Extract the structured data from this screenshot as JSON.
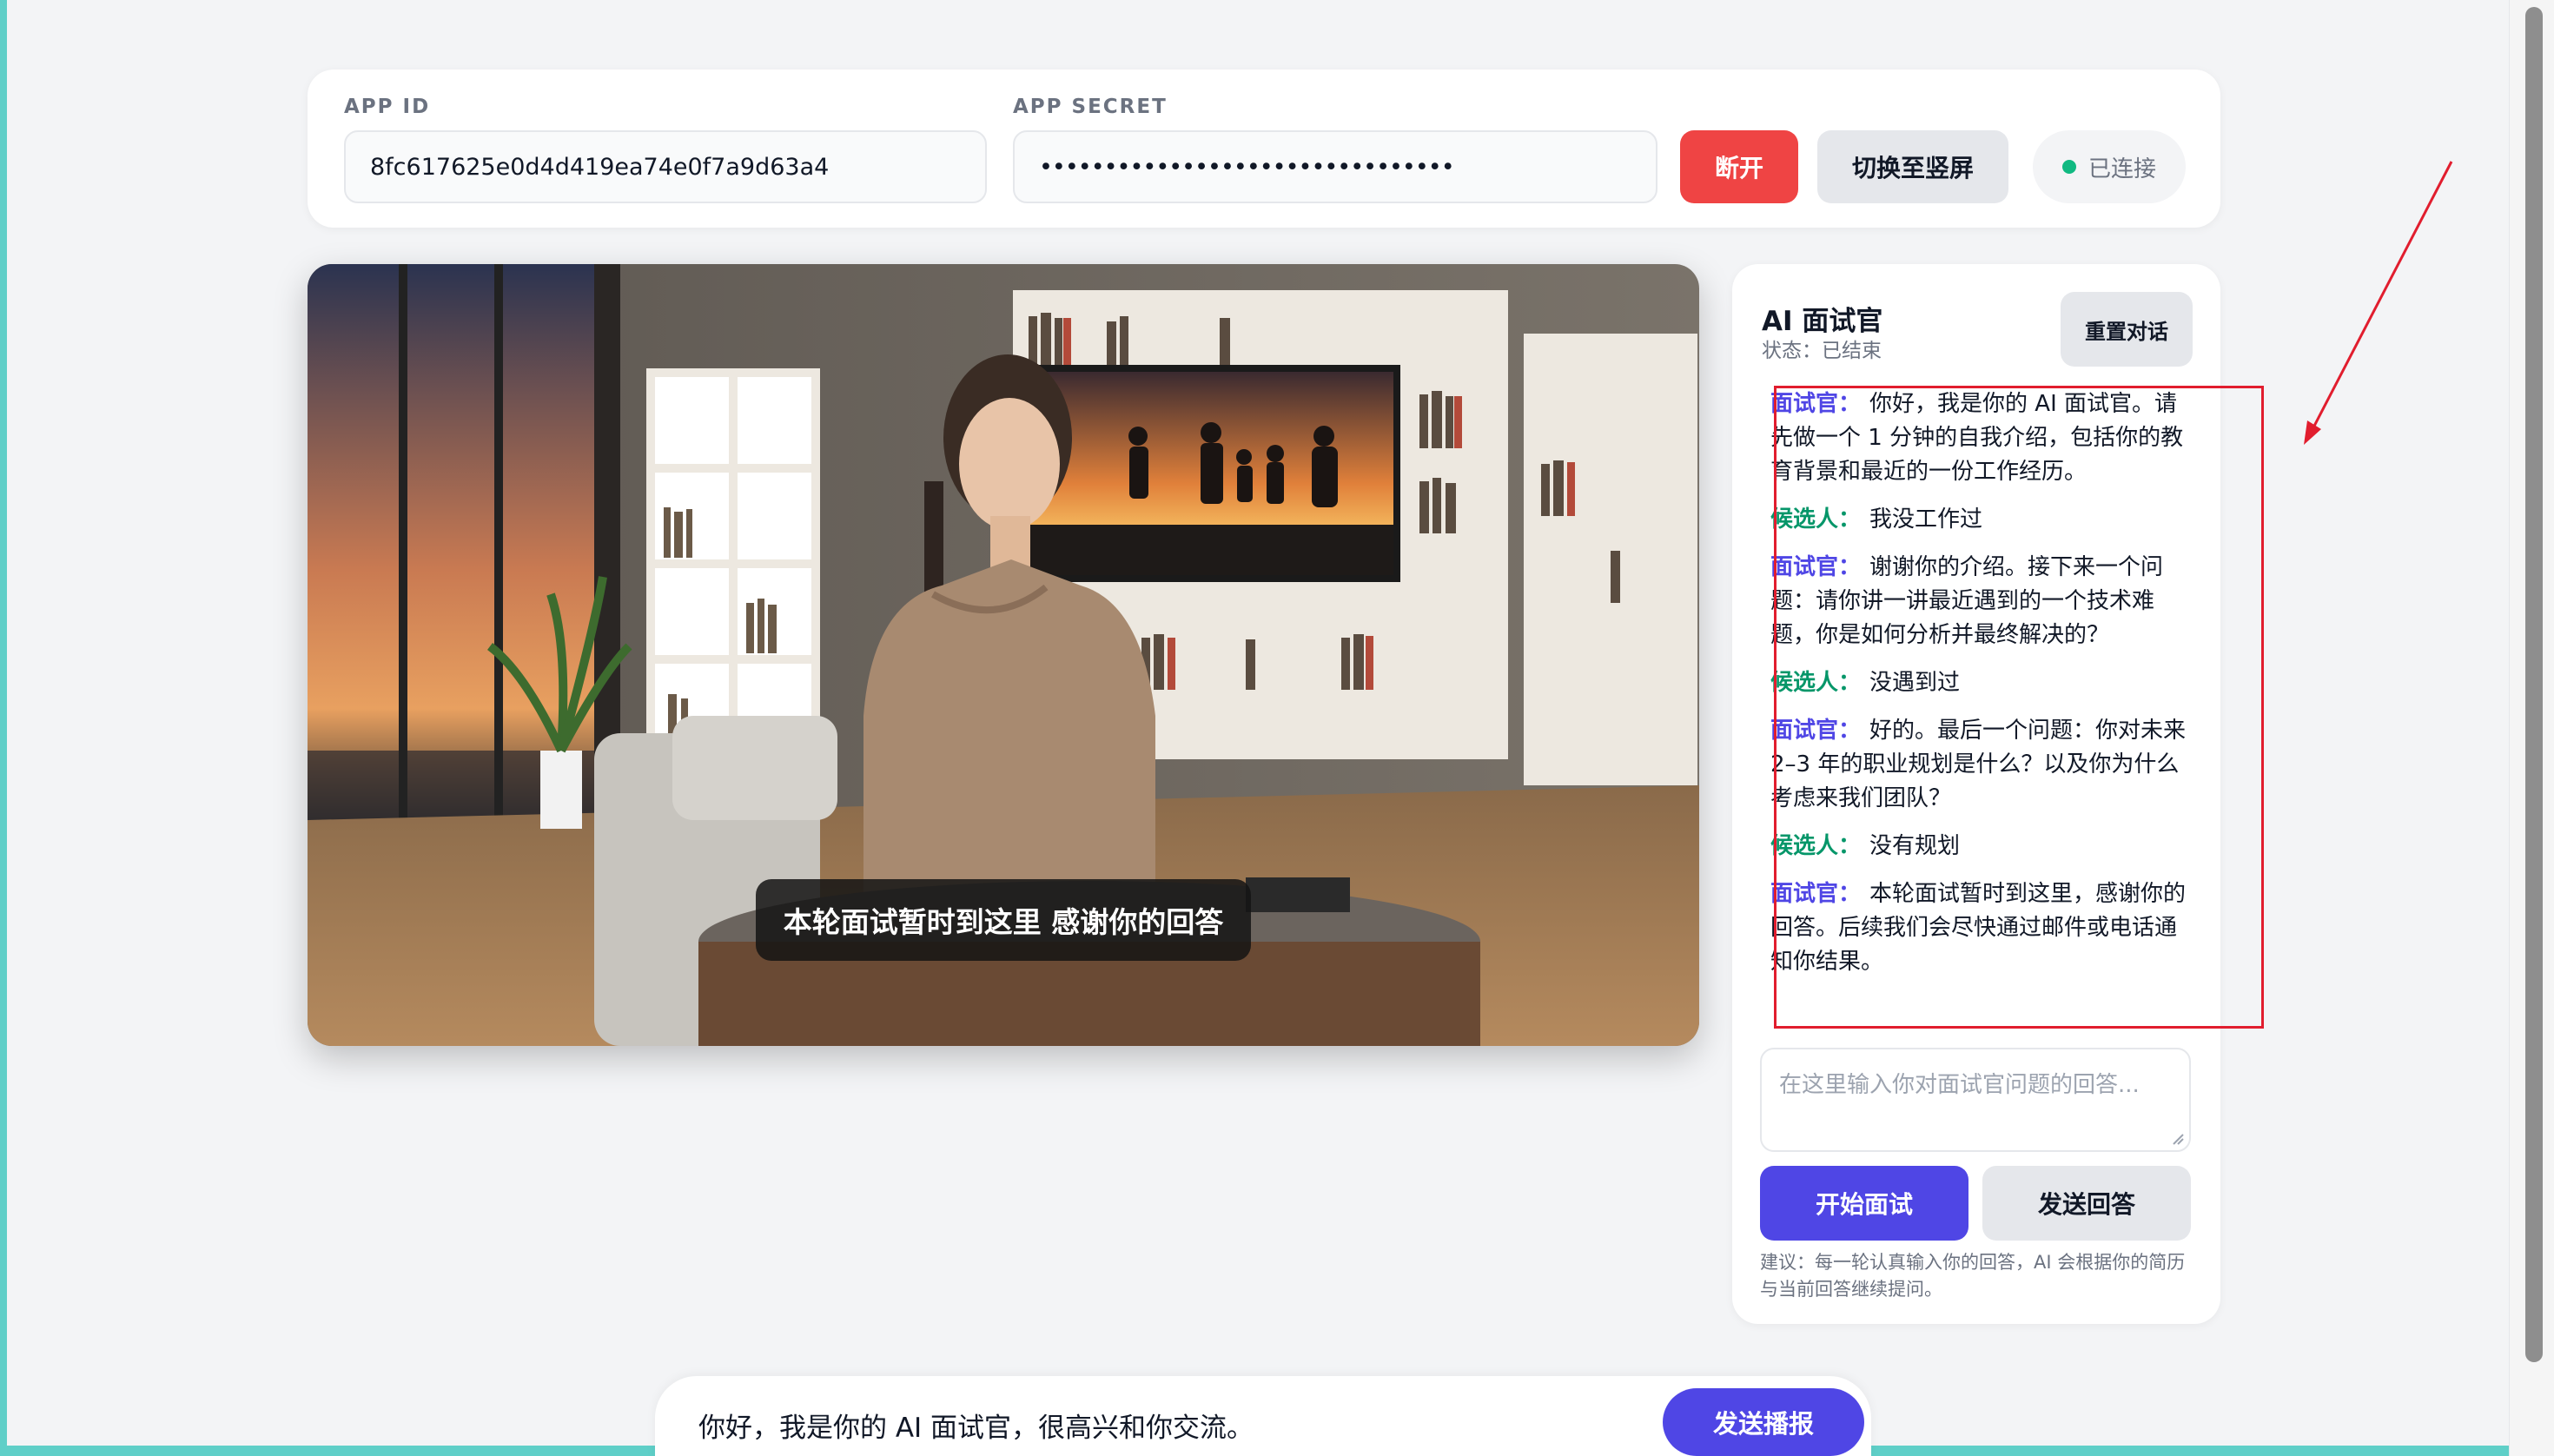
{
  "config": {
    "app_id_label": "APP ID",
    "app_id_value": "8fc617625e0d4d419ea74e0f7a9d63a4",
    "app_secret_label": "APP SECRET",
    "app_secret_value": "••••••••••••••••••••••••••••••••",
    "disconnect_label": "断开",
    "switch_orientation_label": "切换至竖屏",
    "connection_status": "已连接"
  },
  "stage": {
    "subtitle": "本轮面试暂时到这里 感谢你的回答"
  },
  "panel": {
    "title": "AI 面试官",
    "status": "状态：已结束",
    "reset_label": "重置对话",
    "messages": [
      {
        "speaker": "面试官：",
        "text": "你好，我是你的 AI 面试官。请先做一个 1 分钟的自我介绍，包括你的教育背景和最近的一份工作经历。"
      },
      {
        "speaker": "候选人：",
        "text": "我没工作过"
      },
      {
        "speaker": "面试官：",
        "text": "谢谢你的介绍。接下来一个问题：请你讲一讲最近遇到的一个技术难题，你是如何分析并最终解决的？"
      },
      {
        "speaker": "候选人：",
        "text": "没遇到过"
      },
      {
        "speaker": "面试官：",
        "text": "好的。最后一个问题：你对未来 2–3 年的职业规划是什么？以及你为什么考虑来我们团队？"
      },
      {
        "speaker": "候选人：",
        "text": "没有规划"
      },
      {
        "speaker": "面试官：",
        "text": "本轮面试暂时到这里，感谢你的回答。后续我们会尽快通过邮件或电话通知你结果。"
      }
    ],
    "reply_placeholder": "在这里输入你对面试官问题的回答...",
    "start_label": "开始面试",
    "send_label": "发送回答",
    "hint": "建议：每一轮认真输入你的回答，AI 会根据你的简历与当前回答继续提问。"
  },
  "broadcast": {
    "text": "你好，我是你的 AI 面试官，很高兴和你交流。",
    "button_label": "发送播报"
  },
  "colors": {
    "primary": "#4f46e5",
    "danger": "#ef4444",
    "connected": "#10b981",
    "interviewer": "#4f46e5",
    "candidate": "#059669",
    "annotation": "#e11d2e"
  }
}
